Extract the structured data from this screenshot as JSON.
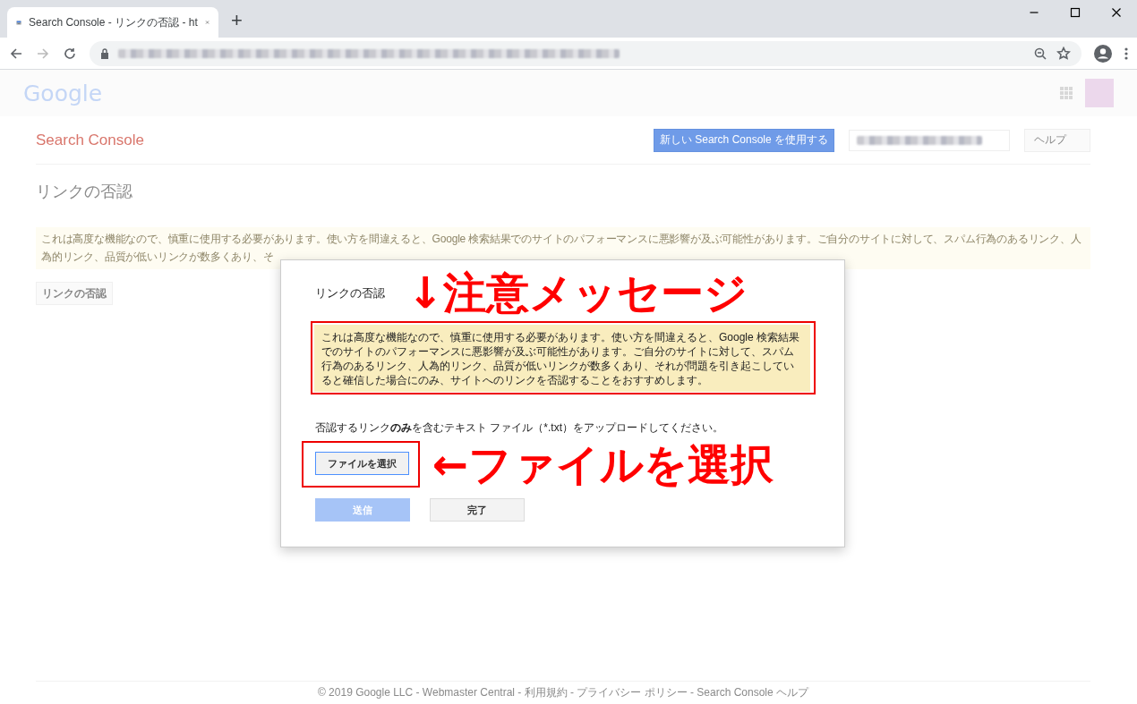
{
  "browser": {
    "tab_title": "Search Console - リンクの否認 - ht",
    "new_tab": "+"
  },
  "header": {
    "logo": "Google"
  },
  "subheader": {
    "product": "Search Console",
    "new_console_button": "新しい Search Console を使用する",
    "help_button": "ヘルプ"
  },
  "page": {
    "title": "リンクの否認",
    "warning_lines": [
      "これは高度な機能なので、慎重に使用する必要があります。使い方を間違えると、Google 検索結果でのサイトのパフォーマンスに悪影響が及ぶ可能性があります。ご自分のサイトに対して、スパム行為のあるリンク、人",
      "為的リンク、品質が低いリンクが数多くあり、そ"
    ],
    "disavow_button": "リンクの否認"
  },
  "dialog": {
    "title": "リンクの否認",
    "warning": "これは高度な機能なので、慎重に使用する必要があります。使い方を間違えると、Google 検索結果でのサイトのパフォーマンスに悪影響が及ぶ可能性があります。ご自分のサイトに対して、スパム行為のあるリンク、人為的リンク、品質が低いリンクが数多くあり、それが問題を引き起こしていると確信した場合にのみ、サイトへのリンクを否認することをおすすめします。",
    "instruction": "否認するリンク**のみ**を含むテキスト ファイル（*.txt）をアップロードしてください。",
    "choose_file_button": "ファイルを選択",
    "buttons": [
      {
        "label": "送信",
        "kind": "primary",
        "disabled": true
      },
      {
        "label": "完了",
        "kind": "secondary",
        "disabled": false
      }
    ]
  },
  "annotations": [
    {
      "text": "↓注意メッセージ"
    },
    {
      "text": "←ファイルを選択"
    }
  ],
  "footer": "© 2019 Google LLC - Webmaster Central - 利用規約 - プライバシー ポリシー - Search Console ヘルプ"
}
